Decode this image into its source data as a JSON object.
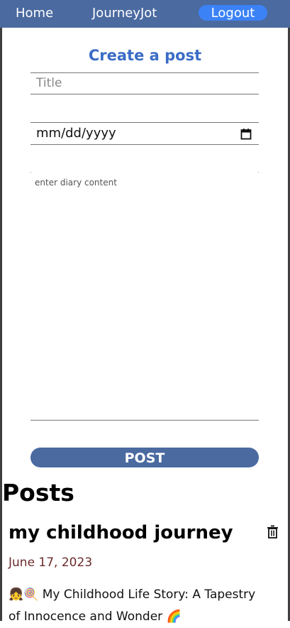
{
  "nav": {
    "home": "Home",
    "brand": "JourneyJot",
    "logout": "Logout"
  },
  "form": {
    "heading": "Create a post",
    "title_placeholder": "Title",
    "date_placeholder": "mm/dd/yyyy",
    "content_placeholder": "enter diary content",
    "submit": "POST"
  },
  "posts": {
    "heading": "Posts",
    "items": [
      {
        "title": "my childhood journey",
        "date": "June 17, 2023",
        "excerpt": "👧🍭 My Childhood Life Story: A Tapestry of Innocence and Wonder 🌈"
      }
    ]
  },
  "colors": {
    "navbar": "#4a6aa0",
    "logout": "#3b82f6",
    "heading": "#3b6cc5",
    "date": "#6b2b2b"
  }
}
